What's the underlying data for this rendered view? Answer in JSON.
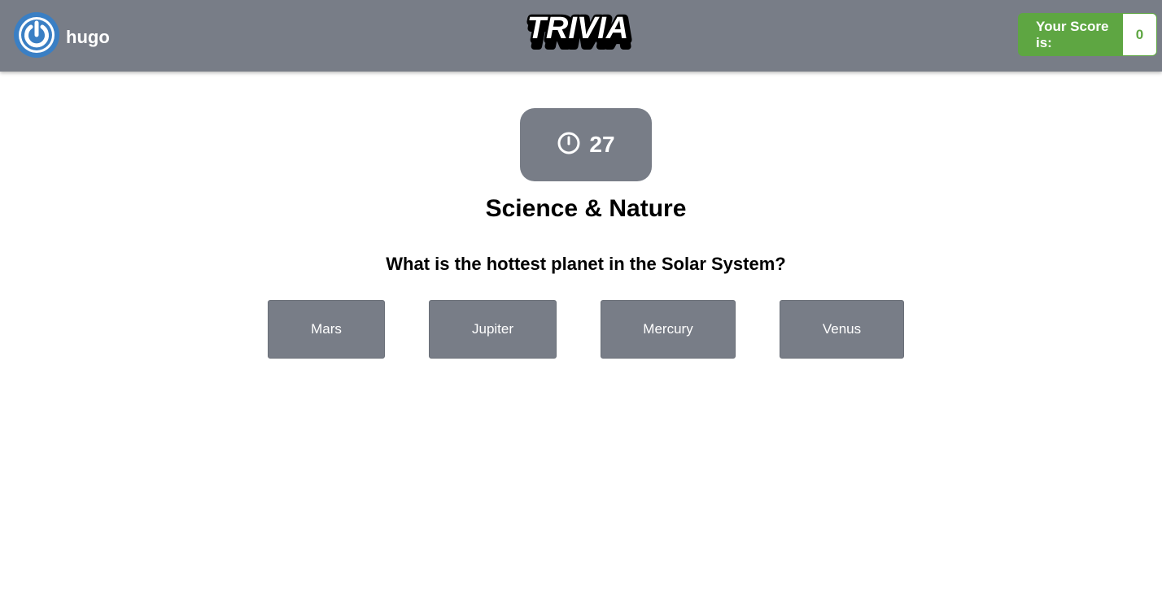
{
  "header": {
    "username": "hugo",
    "logo_text": "TRIVIA",
    "score_label": "Your Score is:",
    "score_value": "0",
    "avatar_icon": "power-icon"
  },
  "timer": {
    "icon": "clock-icon",
    "seconds_left": "27"
  },
  "question": {
    "category": "Science & Nature",
    "text": "What is the hottest planet in the Solar System?",
    "answers": [
      "Mars",
      "Jupiter",
      "Mercury",
      "Venus"
    ]
  },
  "colors": {
    "header_bg": "#787d87",
    "score_green": "#5ea642",
    "avatar_blue": "#3a7fc4",
    "button_gray": "#787d87"
  }
}
